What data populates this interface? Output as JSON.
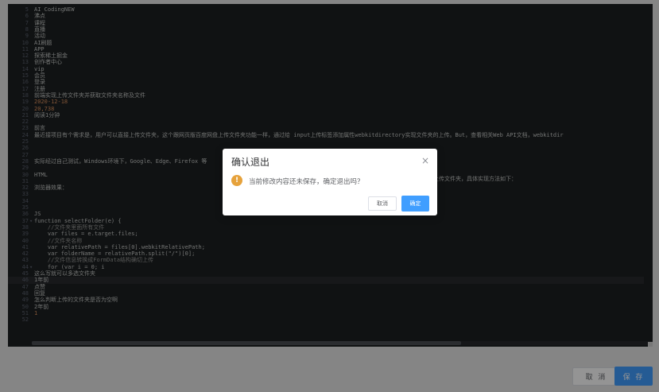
{
  "editor": {
    "lines": [
      {
        "n": "5",
        "fold": "",
        "text": "AI CodingNEW",
        "cls": "c-text"
      },
      {
        "n": "6",
        "fold": "",
        "text": "沸点",
        "cls": "c-text"
      },
      {
        "n": "7",
        "fold": "",
        "text": "课程",
        "cls": "c-text"
      },
      {
        "n": "8",
        "fold": "",
        "text": "直播",
        "cls": "c-text"
      },
      {
        "n": "9",
        "fold": "",
        "text": "活动",
        "cls": "c-text"
      },
      {
        "n": "10",
        "fold": "",
        "text": "AI刷题",
        "cls": "c-text"
      },
      {
        "n": "11",
        "fold": "",
        "text": "APP",
        "cls": "c-text"
      },
      {
        "n": "12",
        "fold": "",
        "text": "探索稀土掘金",
        "cls": "c-text"
      },
      {
        "n": "13",
        "fold": "",
        "text": "创作者中心",
        "cls": "c-text"
      },
      {
        "n": "14",
        "fold": "",
        "text": "vip",
        "cls": "c-text"
      },
      {
        "n": "15",
        "fold": "",
        "text": "会员",
        "cls": "c-text"
      },
      {
        "n": "16",
        "fold": "",
        "text": "登录",
        "cls": "c-text"
      },
      {
        "n": "17",
        "fold": "",
        "text": "注册",
        "cls": "c-text"
      },
      {
        "n": "18",
        "fold": "",
        "text": "前端实现上传文件夹并获取文件夹名称及文件",
        "cls": "c-text"
      },
      {
        "n": "19",
        "fold": "",
        "text": "2020-12-18",
        "cls": "c-num"
      },
      {
        "n": "20",
        "fold": "",
        "text": "20,738",
        "cls": "c-num"
      },
      {
        "n": "21",
        "fold": "",
        "text": "阅读1分钟",
        "cls": "c-text"
      },
      {
        "n": "22",
        "fold": "",
        "text": "",
        "cls": "c-text"
      },
      {
        "n": "23",
        "fold": "",
        "text": "前言",
        "cls": "c-text"
      },
      {
        "n": "24",
        "fold": "",
        "text": "最近接项目有个需求是，用户可以直接上传文件夹，这个跟网页版百度网盘上传文件夹功能一样，通过给 input上传标签添加属性webkitdirectory实现文件夹的上传。But，查看相关Web API文档，webkitdir",
        "cls": "c-text"
      },
      {
        "n": "25",
        "fold": "",
        "text": "",
        "cls": "c-text"
      },
      {
        "n": "26",
        "fold": "",
        "text": "",
        "cls": "c-text"
      },
      {
        "n": "27",
        "fold": "",
        "text": "",
        "cls": "c-text"
      },
      {
        "n": "28",
        "fold": "",
        "text": "实际经过自己测试，Windows环境下，Google、Edge、Firefox 等",
        "cls": "c-text"
      },
      {
        "n": "29",
        "fold": "",
        "text": "",
        "cls": "c-text"
      },
      {
        "n": "30",
        "fold": "",
        "text": "HTML",
        "cls": "c-text"
      },
      {
        "n": "31",
        "fold": "",
        "text": "",
        "cls": "c-text"
      },
      {
        "n": "32",
        "fold": "",
        "text": "浏览器效果：",
        "cls": "c-text"
      },
      {
        "n": "33",
        "fold": "",
        "text": "",
        "cls": "c-text"
      },
      {
        "n": "34",
        "fold": "",
        "text": "",
        "cls": "c-text"
      },
      {
        "n": "35",
        "fold": "",
        "text": "",
        "cls": "c-text"
      },
      {
        "n": "36",
        "fold": "",
        "text": "JS",
        "cls": "c-text"
      },
      {
        "n": "37",
        "fold": "▾",
        "text": "function selectFolder(e) {",
        "cls": "c-text"
      },
      {
        "n": "38",
        "fold": "",
        "text": "    //文件夹里面所有文件",
        "cls": "c-comment"
      },
      {
        "n": "39",
        "fold": "",
        "text": "    var files = e.target.files;",
        "cls": "c-text"
      },
      {
        "n": "40",
        "fold": "",
        "text": "    //文件夹名称",
        "cls": "c-comment"
      },
      {
        "n": "41",
        "fold": "",
        "text": "    var relativePath = files[0].webkitRelativePath;",
        "cls": "c-text"
      },
      {
        "n": "42",
        "fold": "",
        "text": "    var folderName = relativePath.split(\"/\")[0];",
        "cls": "c-text"
      },
      {
        "n": "43",
        "fold": "",
        "text": "    //文件信息转换成FormData结构确切上传",
        "cls": "c-comment"
      },
      {
        "n": "44",
        "fold": "▾",
        "text": "    for (var i = 0; i",
        "cls": "c-text"
      },
      {
        "n": "45",
        "fold": "",
        "text": "这么写就可以多选文件夹",
        "cls": "c-text"
      },
      {
        "n": "46",
        "fold": "",
        "text": "1年前",
        "cls": "c-text"
      },
      {
        "n": "47",
        "fold": "",
        "text": "点赞",
        "cls": "c-text"
      },
      {
        "n": "48",
        "fold": "",
        "text": "回复",
        "cls": "c-text"
      },
      {
        "n": "49",
        "fold": "",
        "text": "怎么判断上传的文件夹是否为空啊",
        "cls": "c-text"
      },
      {
        "n": "50",
        "fold": "",
        "text": "2年前",
        "cls": "c-text"
      },
      {
        "n": "51",
        "fold": "",
        "text": "1",
        "cls": "c-num"
      },
      {
        "n": "52",
        "fold": "",
        "text": "",
        "cls": "c-text"
      }
    ],
    "line24_tail": "为实现点击上传文件夹，具体实现方法如下："
  },
  "footer": {
    "cancel_label": "取 消",
    "save_label": "保 存"
  },
  "dialog": {
    "title": "确认退出",
    "close_glyph": "×",
    "warn_glyph": "!",
    "message": "当前修改内容还未保存，确定退出吗？",
    "cancel_label": "取消",
    "ok_label": "确定"
  },
  "colors": {
    "primary": "#409eff",
    "warning": "#e6a23c",
    "editor_bg": "#1d1f21"
  }
}
